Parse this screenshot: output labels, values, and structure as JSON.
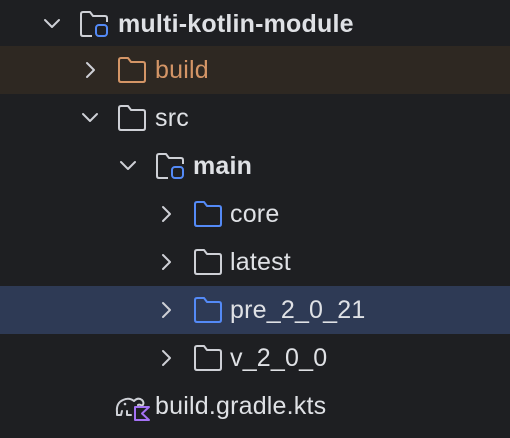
{
  "colors": {
    "background": "#1e1f22",
    "selected_row": "#2e3a55",
    "excluded_row": "#2e2822",
    "text": "#dfe1e5",
    "excluded_text": "#d49566",
    "folder_gray": "#ced0d6",
    "folder_blue": "#548af7",
    "kotlin_purple": "#a472f5"
  },
  "tree": {
    "root": {
      "label": "multi-kotlin-module",
      "icon": "module-folder-icon",
      "expanded": true
    },
    "build": {
      "label": "build",
      "icon": "excluded-folder-icon",
      "expanded": false
    },
    "src": {
      "label": "src",
      "icon": "folder-icon",
      "expanded": true
    },
    "main": {
      "label": "main",
      "icon": "module-folder-icon",
      "expanded": true
    },
    "core": {
      "label": "core",
      "icon": "source-folder-icon",
      "expanded": false
    },
    "latest": {
      "label": "latest",
      "icon": "folder-icon",
      "expanded": false
    },
    "pre_2_0_21": {
      "label": "pre_2_0_21",
      "icon": "source-folder-icon",
      "expanded": false,
      "selected": true
    },
    "v_2_0_0": {
      "label": "v_2_0_0",
      "icon": "folder-icon",
      "expanded": false
    },
    "gradle": {
      "label": "build.gradle.kts",
      "icon": "gradle-kotlin-script-icon"
    }
  }
}
